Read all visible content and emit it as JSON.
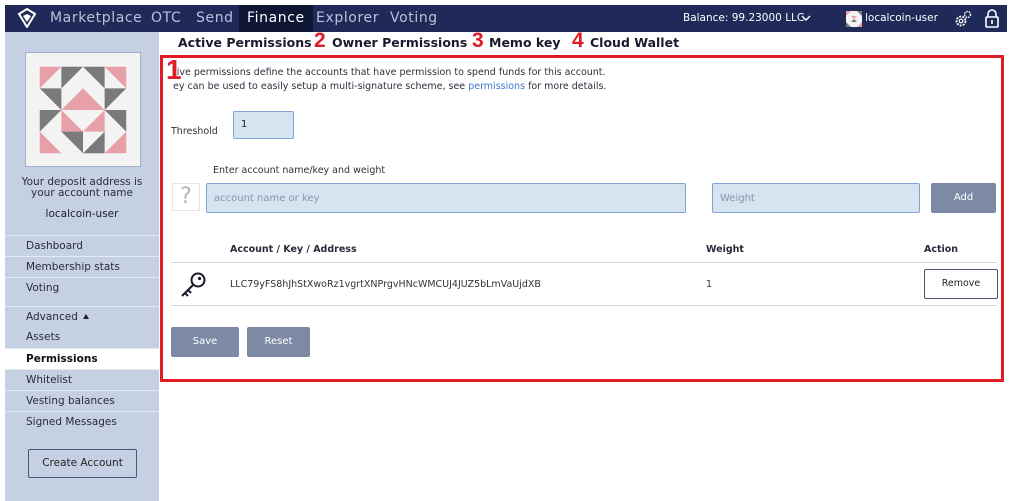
{
  "nav": {
    "items": [
      "Marketplace",
      "OTC",
      "Send",
      "Finance",
      "Explorer",
      "Voting"
    ],
    "active": "Finance",
    "balance": "Balance: 99.23000 LLC",
    "account": "localcoin-user"
  },
  "sidebar": {
    "deposit_text_line1": "Your deposit address is",
    "deposit_text_line2": "your account name",
    "account_name": "localcoin-user",
    "items": {
      "dashboard": "Dashboard",
      "membership": "Membership stats",
      "voting": "Voting",
      "advanced": "Advanced",
      "assets": "Assets",
      "permissions": "Permissions",
      "whitelist": "Whitelist",
      "vesting": "Vesting balances",
      "signed_messages": "Signed Messages"
    },
    "create_account": "Create Account"
  },
  "tabs": {
    "active": "Active Permissions",
    "owner": "Owner Permissions",
    "memo": "Memo key",
    "cloud": "Cloud Wallet"
  },
  "steps": {
    "panel": "1",
    "owner": "2",
    "memo": "3",
    "cloud": "4"
  },
  "panel": {
    "description_line1": "tive permissions define the accounts that have permission to spend funds for this account.",
    "description_line2_prefix": "ey can be used to easily setup a multi-signature scheme, see",
    "description_link": "permissions",
    "description_line2_suffix": "for more details.",
    "threshold_label": "Threshold",
    "threshold_value": "1",
    "entry_label": "Enter account name/key and weight",
    "question_mark": "?",
    "account_placeholder": "account name or key",
    "weight_placeholder": "Weight",
    "add_label": "Add",
    "table": {
      "headers": {
        "account": "Account / Key / Address",
        "weight": "Weight",
        "action": "Action"
      },
      "rows": [
        {
          "key": "LLC79yFS8hJhStXwoRz1vgrtXNPrgvHNcWMCUJ4JUZ5bLmVaUjdXB",
          "weight": "1",
          "action": "Remove"
        }
      ]
    },
    "save_label": "Save",
    "reset_label": "Reset"
  },
  "colors": {
    "topbar": "#1f2a58",
    "sidebar": "#c5d1e3",
    "highlight": "#e01b24",
    "button": "#7d8aa6",
    "link": "#3f78d1"
  },
  "icons": [
    "localcoin-logo-icon",
    "chevron-down-icon",
    "identicon-avatar",
    "gear-icon",
    "lock-icon",
    "key-icon",
    "question-icon",
    "caret-up-icon"
  ]
}
